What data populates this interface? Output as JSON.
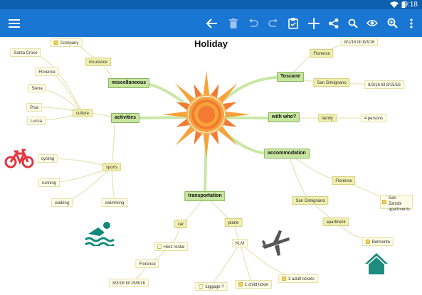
{
  "status_bar": {
    "time": "9:18",
    "icons": [
      "wifi-icon",
      "battery-icon"
    ]
  },
  "toolbar": {
    "icons": [
      "menu-icon",
      "back-arrow-icon",
      "delete-icon",
      "undo-icon",
      "redo-icon",
      "clipboard-icon",
      "add-icon",
      "share-icon",
      "search-icon",
      "view-icon",
      "zoom-icon",
      "more-icon"
    ],
    "colors": {
      "bar": "#1976d2",
      "status": "#0d5fb0"
    }
  },
  "map": {
    "title": "Holiday",
    "central_image": "sun-icon",
    "branches": {
      "miscellaneous": {
        "label": "miscellaneous",
        "children": {
          "insurance": "insurance",
          "company": "Company"
        }
      },
      "activities": {
        "label": "activities",
        "culture": {
          "label": "culture",
          "items": [
            "Santa Croce",
            "Florence",
            "Siena",
            "Pisa",
            "Lucca"
          ]
        },
        "sports": {
          "label": "sports",
          "items": [
            "cycling",
            "running",
            "walking",
            "swimming"
          ]
        }
      },
      "toscane": {
        "label": "Toscane",
        "florence": "Florence",
        "florence_dates": "8/1/16 till 8/3/16",
        "san_gimignano": "San Gimignano",
        "sg_dates": "8/3/16 till 8/15/16"
      },
      "with_who": {
        "label": "with who?",
        "family": "family",
        "persons": "4 persons"
      },
      "accommodation": {
        "label": "accommodation",
        "florence": "Florence",
        "san_zanobi": "San Zanobi apartments",
        "san_gimignano": "San Gimignano",
        "apartment": "apartment",
        "belmonte": "Belmonte"
      },
      "transportation": {
        "label": "transportation",
        "car": "car",
        "herz": "Herz rental",
        "florence": "Florence",
        "car_dates": "8/3/16 till 15/8/16",
        "plane": "plane",
        "klm": "KLM",
        "luggage": "luggage ?",
        "child_ticket": "1 child ticket",
        "adult_tickets": "3 adult tickets"
      }
    },
    "decorations": [
      "bicycle-icon",
      "swimmer-icon",
      "airplane-icon",
      "house-icon"
    ],
    "colors": {
      "sun_outer": "#f7a23a",
      "sun_inner": "#f27a32",
      "main_node": "#c8e6a0",
      "leaf_node": "#fffde7",
      "bicycle": "#e5343d",
      "swimmer": "#0f8a7a",
      "airplane": "#555555",
      "house": "#1f8c80",
      "branch": "#bfe39a"
    }
  }
}
